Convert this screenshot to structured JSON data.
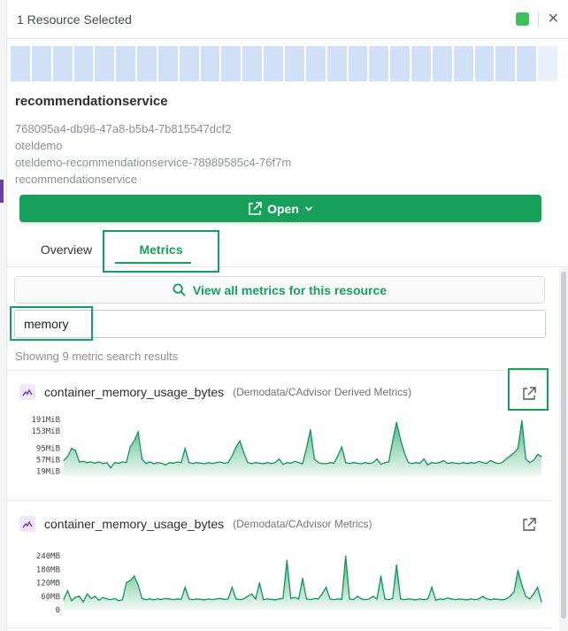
{
  "header": {
    "title": "1 Resource Selected",
    "status_color": "#3bc15a",
    "close_label": "✕"
  },
  "heatmap": {
    "cell_count": 26,
    "color": "#cfe0f7"
  },
  "resource": {
    "name": "recommendationservice",
    "meta": [
      "768095a4-db96-47a8-b5b4-7b815547dcf2",
      "oteldemo",
      "oteldemo-recommendationservice-78989585c4-76f7m",
      "recommendationservice"
    ]
  },
  "open_button": {
    "label": "Open",
    "color": "#16a05a"
  },
  "tabs": [
    {
      "label": "Overview",
      "active": false
    },
    {
      "label": "Metrics",
      "active": true
    }
  ],
  "metrics_panel": {
    "view_all_label": "View all metrics for this resource",
    "search_value": "memory",
    "result_count": "Showing 9 metric search results",
    "accent_color": "#16a05a"
  },
  "metrics": [
    {
      "name": "container_memory_usage_bytes",
      "source": "(Demodata/CAdvisor Derived Metrics)",
      "chart_data": {
        "type": "area",
        "y_ticks": [
          "191MiB",
          "153MiB",
          "95MiB",
          "57MiB",
          "19MiB"
        ],
        "y_tick_values": [
          191,
          153,
          95,
          57,
          19
        ],
        "ylim": [
          0,
          200
        ],
        "unit": "MiB",
        "values": [
          55,
          68,
          95,
          88,
          50,
          52,
          48,
          50,
          46,
          50,
          45,
          48,
          30,
          48,
          46,
          50,
          48,
          100,
          120,
          150,
          60,
          45,
          50,
          44,
          48,
          46,
          40,
          48,
          46,
          50,
          48,
          95,
          48,
          45,
          48,
          46,
          44,
          48,
          45,
          48,
          50,
          46,
          48,
          70,
          100,
          120,
          80,
          48,
          45,
          48,
          46,
          44,
          48,
          45,
          48,
          60,
          42,
          48,
          46,
          52,
          48,
          44,
          95,
          158,
          60,
          48,
          45,
          44,
          48,
          46,
          70,
          100,
          48,
          45,
          48,
          46,
          44,
          48,
          45,
          48,
          60,
          42,
          48,
          50,
          120,
          182,
          125,
          80,
          48,
          45,
          48,
          46,
          60,
          40,
          48,
          46,
          48,
          55,
          45,
          48,
          46,
          44,
          48,
          45,
          48,
          46,
          52,
          48,
          45,
          55,
          48,
          45,
          48,
          60,
          70,
          80,
          95,
          188,
          60,
          48,
          55,
          75,
          68
        ]
      }
    },
    {
      "name": "container_memory_usage_bytes",
      "source": "(Demodata/CAdvisor Metrics)",
      "chart_data": {
        "type": "area",
        "y_ticks": [
          "240MB",
          "180MB",
          "120MB",
          "60MB",
          "0"
        ],
        "y_tick_values": [
          240,
          180,
          120,
          60,
          0
        ],
        "ylim": [
          0,
          240
        ],
        "unit": "MB",
        "values": [
          45,
          85,
          40,
          55,
          60,
          35,
          70,
          50,
          60,
          42,
          55,
          48,
          45,
          50,
          40,
          45,
          120,
          130,
          150,
          110,
          50,
          45,
          48,
          44,
          48,
          46,
          50,
          48,
          45,
          48,
          46,
          100,
          48,
          45,
          48,
          46,
          44,
          48,
          45,
          48,
          50,
          46,
          48,
          100,
          48,
          45,
          48,
          60,
          70,
          48,
          120,
          45,
          48,
          46,
          44,
          48,
          50,
          220,
          50,
          55,
          48,
          140,
          48,
          45,
          50,
          48,
          70,
          100,
          48,
          45,
          48,
          46,
          240,
          48,
          45,
          60,
          48,
          45,
          48,
          60,
          48,
          150,
          48,
          45,
          50,
          200,
          48,
          45,
          48,
          46,
          44,
          48,
          45,
          48,
          100,
          42,
          48,
          46,
          52,
          48,
          45,
          48,
          46,
          44,
          48,
          45,
          48,
          60,
          48,
          45,
          48,
          46,
          44,
          48,
          60,
          80,
          175,
          110,
          60,
          48,
          70,
          100,
          35
        ]
      }
    }
  ]
}
